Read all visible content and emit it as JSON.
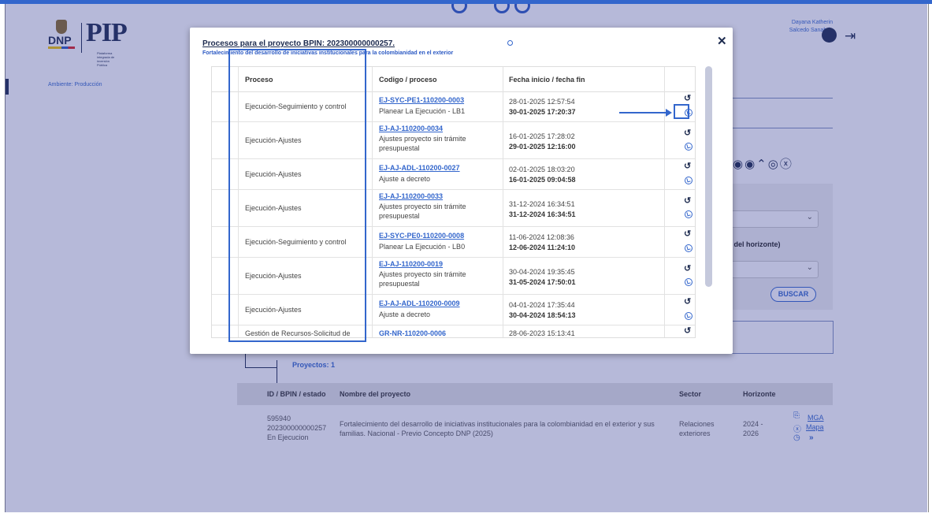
{
  "header": {
    "dnp_label": "DNP",
    "pip_label": "PIP",
    "pip_subtitle": "Plataforma integrada de inversión Pública",
    "ambiente": "Ambiente: Producción",
    "user_line1": "Dayana Katherin",
    "user_line2": "Salcedo Sanabria"
  },
  "background": {
    "buscar_label": "BUSCAR",
    "horizon_label": "ro del horizonte)",
    "proyectos_label": "Proyectos: 1",
    "results": {
      "headers": [
        "ID / BPIN / estado",
        "Nombre del proyecto",
        "Sector",
        "Horizonte"
      ],
      "row": {
        "id": "595940",
        "bpin": "202300000000257",
        "estado": "En Ejecucion",
        "nombre": "Fortalecimiento del desarrollo de iniciativas institucionales para la colombianidad en el exterior y sus familias. Nacional - Previo Concepto DNP (2025)",
        "sector": "Relaciones exteriores",
        "horizonte": "2024 - 2026",
        "link_mga": "MGA",
        "link_mapa": "Mapa"
      }
    }
  },
  "modal": {
    "title_prefix": "Procesos para el proyecto ",
    "title_bpin": "BPIN: 202300000000257.",
    "subtitle": "Fortalecimiento del desarrollo de iniciativas institucionales para la colombianidad en el exterior",
    "columns": [
      "Proceso",
      "Codigo / proceso",
      "Fecha inicio / fecha fin"
    ],
    "rows": [
      {
        "proceso": "Ejecución-Seguimiento y control",
        "codigo": "EJ-SYC-PE1-110200-0003",
        "descripcion": "Planear La Ejecución - LB1",
        "inicio": "28-01-2025 12:57:54",
        "fin": "30-01-2025 17:20:37"
      },
      {
        "proceso": "Ejecución-Ajustes",
        "codigo": "EJ-AJ-110200-0034",
        "descripcion": "Ajustes proyecto sin trámite presupuestal",
        "inicio": "16-01-2025 17:28:02",
        "fin": "29-01-2025 12:16:00"
      },
      {
        "proceso": "Ejecución-Ajustes",
        "codigo": "EJ-AJ-ADL-110200-0027",
        "descripcion": "Ajuste a decreto",
        "inicio": "02-01-2025 18:03:20",
        "fin": "16-01-2025 09:04:58"
      },
      {
        "proceso": "Ejecución-Ajustes",
        "codigo": "EJ-AJ-110200-0033",
        "descripcion": "Ajustes proyecto sin trámite presupuestal",
        "inicio": "31-12-2024 16:34:51",
        "fin": "31-12-2024 16:34:51"
      },
      {
        "proceso": "Ejecución-Seguimiento y control",
        "codigo": "EJ-SYC-PE0-110200-0008",
        "descripcion": "Planear La Ejecución - LB0",
        "inicio": "11-06-2024 12:08:36",
        "fin": "12-06-2024 11:24:10"
      },
      {
        "proceso": "Ejecución-Ajustes",
        "codigo": "EJ-AJ-110200-0019",
        "descripcion": "Ajustes proyecto sin trámite presupuestal",
        "inicio": "30-04-2024 19:35:45",
        "fin": "31-05-2024 17:50:01"
      },
      {
        "proceso": "Ejecución-Ajustes",
        "codigo": "EJ-AJ-ADL-110200-0009",
        "descripcion": "Ajuste a decreto",
        "inicio": "04-01-2024 17:35:44",
        "fin": "30-04-2024 18:54:13"
      },
      {
        "proceso": "Gestión de Recursos-Solicitud de",
        "codigo": "GR-NR-110200-0006",
        "descripcion": "",
        "inicio": "28-06-2023 15:13:41",
        "fin": ""
      }
    ]
  }
}
